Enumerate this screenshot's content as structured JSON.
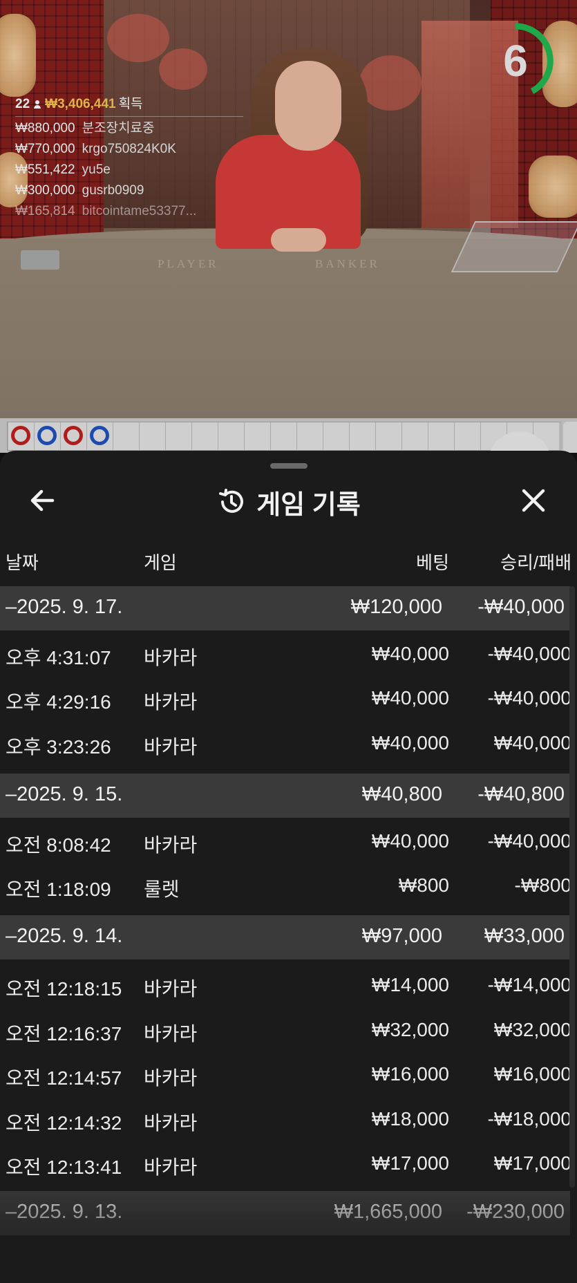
{
  "video": {
    "table_player_label": "PLAYER",
    "table_banker_label": "BANKER",
    "timer_value": "6",
    "timer_color": "#1fa84a",
    "leaderboard": {
      "count": "22",
      "total": "₩3,406,441",
      "total_label": "획득",
      "entries": [
        {
          "amount": "₩880,000",
          "user": "분조장치료중"
        },
        {
          "amount": "₩770,000",
          "user": "krgo750824K0K"
        },
        {
          "amount": "₩551,422",
          "user": "yu5e"
        },
        {
          "amount": "₩300,000",
          "user": "gusrb0909"
        },
        {
          "amount": "₩165,814",
          "user": "bitcointame53377..."
        }
      ]
    }
  },
  "road": {
    "beads": [
      "red",
      "blue",
      "red",
      "blue"
    ]
  },
  "panel": {
    "title": "게임 기록",
    "columns": {
      "date": "날짜",
      "game": "게임",
      "bet": "베팅",
      "result": "승리/패배"
    },
    "groups": [
      {
        "date": "–2025. 9. 17.",
        "bet": "₩120,000",
        "result": "-₩40,000",
        "rows": [
          {
            "time": "오후 4:31:07",
            "game": "바카라",
            "bet": "₩40,000",
            "result": "-₩40,000"
          },
          {
            "time": "오후 4:29:16",
            "game": "바카라",
            "bet": "₩40,000",
            "result": "-₩40,000"
          },
          {
            "time": "오후 3:23:26",
            "game": "바카라",
            "bet": "₩40,000",
            "result": "₩40,000"
          }
        ]
      },
      {
        "date": "–2025. 9. 15.",
        "bet": "₩40,800",
        "result": "-₩40,800",
        "rows": [
          {
            "time": "오전 8:08:42",
            "game": "바카라",
            "bet": "₩40,000",
            "result": "-₩40,000"
          },
          {
            "time": "오전 1:18:09",
            "game": "룰렛",
            "bet": "₩800",
            "result": "-₩800"
          }
        ]
      },
      {
        "date": "–2025. 9. 14.",
        "bet": "₩97,000",
        "result": "₩33,000",
        "rows": [
          {
            "time": "오전 12:18:15",
            "game": "바카라",
            "bet": "₩14,000",
            "result": "-₩14,000"
          },
          {
            "time": "오전 12:16:37",
            "game": "바카라",
            "bet": "₩32,000",
            "result": "₩32,000"
          },
          {
            "time": "오전 12:14:57",
            "game": "바카라",
            "bet": "₩16,000",
            "result": "₩16,000"
          },
          {
            "time": "오전 12:14:32",
            "game": "바카라",
            "bet": "₩18,000",
            "result": "-₩18,000"
          },
          {
            "time": "오전 12:13:41",
            "game": "바카라",
            "bet": "₩17,000",
            "result": "₩17,000"
          }
        ]
      },
      {
        "date": "–2025. 9. 13.",
        "bet": "₩1,665,000",
        "result": "-₩230,000",
        "rows": []
      }
    ]
  }
}
